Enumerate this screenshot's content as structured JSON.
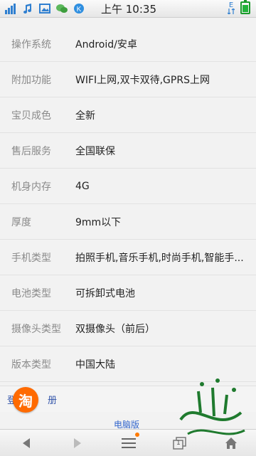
{
  "status_bar": {
    "time": "上午 10:35",
    "icons": [
      "signal-icon",
      "music-icon",
      "image-icon",
      "wechat-icon",
      "k-icon"
    ],
    "right_icons": [
      "data-e-icon",
      "battery-icon"
    ],
    "data_label": "E"
  },
  "specs": [
    {
      "label": "操作系统",
      "value": "Android/安卓"
    },
    {
      "label": "附加功能",
      "value": "WIFI上网,双卡双待,GPRS上网"
    },
    {
      "label": "宝贝成色",
      "value": "全新"
    },
    {
      "label": "售后服务",
      "value": "全国联保"
    },
    {
      "label": "机身内存",
      "value": "4G"
    },
    {
      "label": "厚度",
      "value": "9mm以下"
    },
    {
      "label": "手机类型",
      "value": "拍照手机,音乐手机,时尚手机,智能手..."
    },
    {
      "label": "电池类型",
      "value": "可拆卸式电池"
    },
    {
      "label": "摄像头类型",
      "value": "双摄像头（前后）"
    },
    {
      "label": "版本类型",
      "value": "中国大陆"
    }
  ],
  "footer": {
    "taobao_logo_text": "淘",
    "login_prefix": "登",
    "login_suffix": "册",
    "pc_version": "电脑版"
  },
  "toolbar": {
    "items": [
      "back-icon",
      "forward-icon",
      "menu-icon",
      "windows-icon",
      "home-icon"
    ],
    "windows_count": "1"
  },
  "colors": {
    "accent_orange": "#ff6a00",
    "battery_green": "#22b33a"
  }
}
